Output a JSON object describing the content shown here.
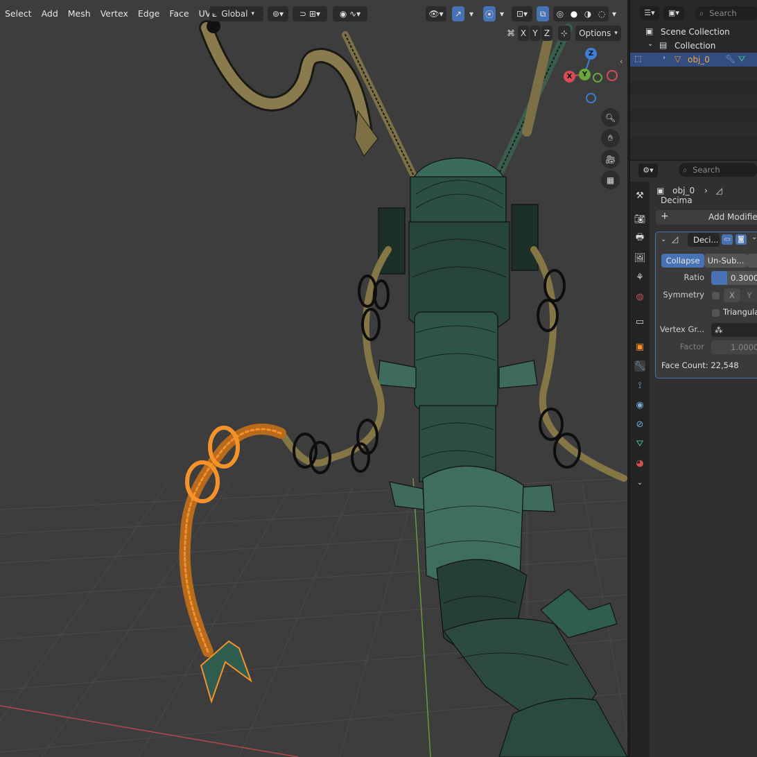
{
  "header": {
    "menu": [
      "Select",
      "Add",
      "Mesh",
      "Vertex",
      "Edge",
      "Face",
      "UV"
    ],
    "orientation": "Global"
  },
  "viewport_overlay": {
    "axes": [
      "X",
      "Y",
      "Z"
    ],
    "options_label": "Options",
    "gizmo": {
      "x": "X",
      "y": "Y",
      "z": "Z"
    }
  },
  "outliner": {
    "search_placeholder": "Search",
    "scene_collection": "Scene Collection",
    "collection": "Collection",
    "object": "obj_0"
  },
  "properties": {
    "search_placeholder": "Search",
    "breadcrumb_object": "obj_0",
    "breadcrumb_modifier": "Decima",
    "add_modifier": "Add Modifier",
    "modifier_name": "Deci...",
    "mode_collapse": "Collapse",
    "mode_unsub": "Un-Sub...",
    "ratio_label": "Ratio",
    "ratio_value": "0.3000",
    "ratio_fraction": 0.3,
    "symmetry_label": "Symmetry",
    "symmetry_x": "X",
    "symmetry_y": "Y",
    "triangulate_label": "Triangulate",
    "vertex_group_label": "Vertex Gr...",
    "factor_label": "Factor",
    "factor_value": "1.0000",
    "face_count": "Face Count: 22,548"
  },
  "colors": {
    "viewport_bg": "#3d3d3d",
    "selection_orange": "#f5922a",
    "mesh_teal": "#2f5e50",
    "mesh_khaki": "#8a7b4e",
    "accent_blue": "#4772b3"
  }
}
